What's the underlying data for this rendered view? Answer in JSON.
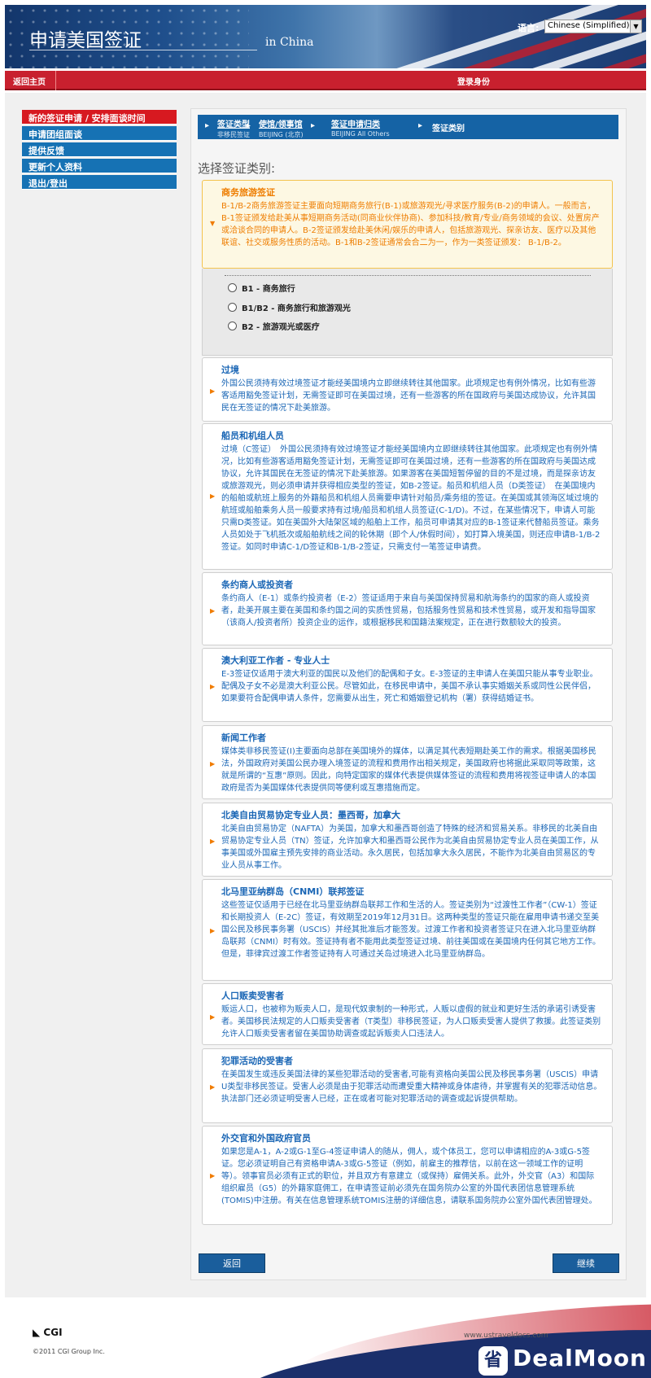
{
  "header": {
    "title": "申请美国签证",
    "subtitle": "in China",
    "language_label": "语言:",
    "language_value": "Chinese (Simplified)"
  },
  "nav": {
    "home": "返回主页",
    "login": "登录身份"
  },
  "sidebar": {
    "items": [
      {
        "label": "新的签证申请 / 安排面谈时间",
        "active": true
      },
      {
        "label": "申请团组面谈"
      },
      {
        "label": "提供反馈"
      },
      {
        "label": "更新个人资料"
      },
      {
        "label": "退出/登出"
      }
    ]
  },
  "breadcrumb": [
    {
      "title": "签证类型",
      "sub": "非移民签证"
    },
    {
      "title": "使馆/领事馆",
      "sub": "BEIJING (北京)"
    },
    {
      "title": "签证申请归类",
      "sub": "BEIJING All Others"
    },
    {
      "title": "签证类别",
      "sub": ""
    }
  ],
  "heading": "选择签证类别:",
  "business": {
    "title": "商务旅游签证",
    "desc": "B-1/B-2商务旅游签证主要面向短期商务旅行(B-1)或旅游观光/寻求医疗服务(B-2)的申请人。一般而言，B-1签证颁发给赴美从事短期商务活动(同商业伙伴协商)、参加科技/教育/专业/商务领域的会议、处置房产或洽谈合同的申请人。B-2签证颁发给赴美休闲/娱乐的申请人，包括旅游观光、探亲访友、医疗以及其他联谊、社交或服务性质的活动。B-1和B-2签证通常会合二为一，作为一类签证颁发： B-1/B-2。",
    "options": [
      "B1 - 商务旅行",
      "B1/B2 - 商务旅行和旅游观光",
      "B2 - 旅游观光或医疗"
    ]
  },
  "cards": [
    {
      "title": "过境",
      "desc": "外国公民须持有效过境签证才能经美国境内立即继续转往其他国家。此项规定也有例外情况，比如有些游客适用豁免签证计划，无需签证即可在美国过境，还有一些游客的所在国政府与美国达成协议，允许其国民在无签证的情况下赴美旅游。"
    },
    {
      "title": "船员和机组人员",
      "desc": "过境（C签证）　外国公民须持有效过境签证才能经美国境内立即继续转往其他国家。此项规定也有例外情况，比如有些游客适用豁免签证计划，无需签证即可在美国过境，还有一些游客的所在国政府与美国达成协议，允许其国民在无签证的情况下赴美旅游。如果游客在美国短暂停留的目的不是过境，而是探亲访友或旅游观光，则必须申请并获得相应类型的签证，如B-2签证。船员和机组人员（D类签证）　在美国境内的船舶或航班上服务的外籍船员和机组人员需要申请针对船员/乘务组的签证。在美国或其领海区域过境的航班或船舶乘务人员一般要求持有过境/船员和机组人员签证(C-1/D)。不过，在某些情况下，申请人可能只需D类签证。如在美国外大陆架区域的船舶上工作，船员可申请其对应的B-1签证来代替船员签证。乘务人员如处于飞机抵次或船舶航线之间的轮休期（即个人/休假时间），如打算入境美国，则还应申请B-1/B-2签证。如同时申请C-1/D签证和B-1/B-2签证，只需支付一笔签证申请费。"
    },
    {
      "title": "条约商人或投资者",
      "desc": "条约商人（E-1）或条约投资者（E-2）签证适用于来自与美国保持贸易和航海条约的国家的商人或投资者，赴美开展主要在美国和条约国之间的实质性贸易，包括服务性贸易和技术性贸易，或开发和指导国家（该商人/投资者所）投资企业的运作，或根据移民和国籍法案规定，正在进行数额较大的投资。"
    },
    {
      "title": "澳大利亚工作者 - 专业人士",
      "desc": "E-3签证仅适用于澳大利亚的国民以及他们的配偶和子女。E-3签证的主申请人在美国只能从事专业职业。配偶及子女不必是澳大利亚公民。尽管如此，在移民申请中，美国不承认事实婚姻关系或同性公民伴侣，如果要符合配偶申请人条件，您需要从出生，死亡和婚姻登记机构（署）获得结婚证书。"
    },
    {
      "title": "新闻工作者",
      "desc": "媒体类非移民签证(I)主要面向总部在美国境外的媒体，以满足其代表短期赴美工作的需求。根据美国移民法，外国政府对美国公民办理入境签证的流程和费用作出相关规定，美国政府也将据此采取同等政策，这就是所谓的“互惠”原则。因此，向特定国家的媒体代表提供媒体签证的流程和费用将视签证申请人的本国政府是否为美国媒体代表提供同等便利或互惠措施而定。"
    },
    {
      "title": "北美自由贸易协定专业人员：墨西哥，加拿大",
      "desc": "北美自由贸易协定（NAFTA）为美国，加拿大和墨西哥创造了特殊的经济和贸易关系。非移民的北美自由贸易协定专业人员（TN）签证，允许加拿大和墨西哥公民作为北美自由贸易协定专业人员在美国工作，从事美国或外国雇主预先安排的商业活动。永久居民，包括加拿大永久居民，不能作为北美自由贸易区的专业人员从事工作。"
    },
    {
      "title": "北马里亚纳群岛（CNMI）联邦签证",
      "desc": "这些签证仅适用于已经在北马里亚纳群岛联邦工作和生活的人。签证类别为“过渡性工作者”（CW-1）签证和长期投资人（E-2C）签证，有效期至2019年12月31日。这两种类型的签证只能在雇用申请书递交至美国公民及移民事务署（USCIS）并经其批准后才能签发。过渡工作者和投资者签证只在进入北马里亚纳群岛联邦（CNMI）时有效。签证持有者不能用此类型签证过境、前往美国或在美国境内任何其它地方工作。但是，菲律宾过渡工作者签证持有人可通过关岛过境进入北马里亚纳群岛。"
    },
    {
      "title": "人口贩卖受害者",
      "desc": "贩运人口，也被称为贩卖人口，是现代奴隶制的一种形式，人贩以虚假的就业和更好生活的承诺引诱受害者。美国移民法规定的人口贩卖受害者（T类型）非移民签证，为人口贩卖受害人提供了救援。此签证类别允许人口贩卖受害者留在美国协助调查或起诉贩卖人口违法人。"
    },
    {
      "title": "犯罪活动的受害者",
      "desc": "在美国发生或违反美国法律的某些犯罪活动的受害者,可能有资格向美国公民及移民事务署（USCIS）申请U类型非移民签证。受害人必须是由于犯罪活动而遭受重大精神或身体虐待，并掌握有关的犯罪活动信息。执法部门还必须证明受害人已经，正在或者可能对犯罪活动的调查或起诉提供帮助。"
    },
    {
      "title": "外交官和外国政府官员",
      "desc": "如果您是A-1，A-2或G-1至G-4签证申请人的随从，佣人，或个体员工，您可以申请相应的A-3或G-5签证。您必须证明自己有资格申请A-3或G-5签证（例如，前雇主的推荐信，以前在这一领域工作的证明等）。领事官员必须有正式的职位，并且双方有意建立（或保持）雇佣关系。此外，外交官（A3）和国际组织雇员（G5）的外籍家庭佣工，在申请签证前必须先在国务院办公室的外国代表团信息管理系统(TOMIS)中注册。有关在信息管理系统TOMIS注册的详细信息，请联系国务院办公室外国代表团管理处。"
    }
  ],
  "buttons": {
    "back": "返回",
    "continue": "继续"
  },
  "footer": {
    "logo": "CGI",
    "copyright": "©2011 CGI Group Inc.",
    "url": "www.ustraveldocs.com",
    "brand": "DealMoon"
  }
}
